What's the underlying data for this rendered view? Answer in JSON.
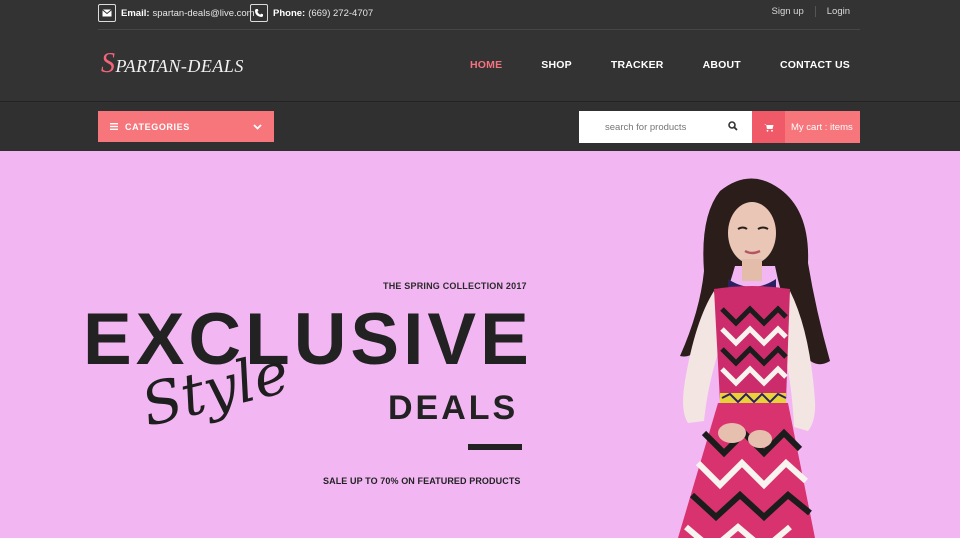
{
  "topbar": {
    "email_label": "Email:",
    "email_value": "spartan-deals@live.com",
    "phone_label": "Phone:",
    "phone_value": "(669) 272-4707",
    "signup": "Sign up",
    "login": "Login"
  },
  "brand": {
    "first_letter": "S",
    "rest": "PARTAN-DEALS"
  },
  "nav": {
    "home": "HOME",
    "shop": "SHOP",
    "tracker": "TRACKER",
    "about": "ABOUT",
    "contact": "CONTACT US"
  },
  "toolbar": {
    "categories": "CATEGORIES",
    "search_placeholder": "search for products",
    "cart_text": "My cart : items"
  },
  "hero": {
    "collection": "THE SPRING COLLECTION 2017",
    "headline": "EXCLUSIVE",
    "script": "Style",
    "deals": "DEALS",
    "sale": "SALE UP TO 70% ON FEATURED PRODUCTS"
  },
  "icons": {
    "email": "envelope-icon",
    "phone": "phone-icon",
    "menu": "hamburger-icon",
    "dropdown": "chevron-down-icon",
    "search": "search-icon",
    "cart": "cart-icon"
  },
  "colors": {
    "accent": "#f6767c",
    "accent_dark": "#f05a68",
    "active_nav": "#f5737f",
    "header_bg": "#333333",
    "hero_bg": "#f2b7f3",
    "text_dark": "#222222"
  }
}
